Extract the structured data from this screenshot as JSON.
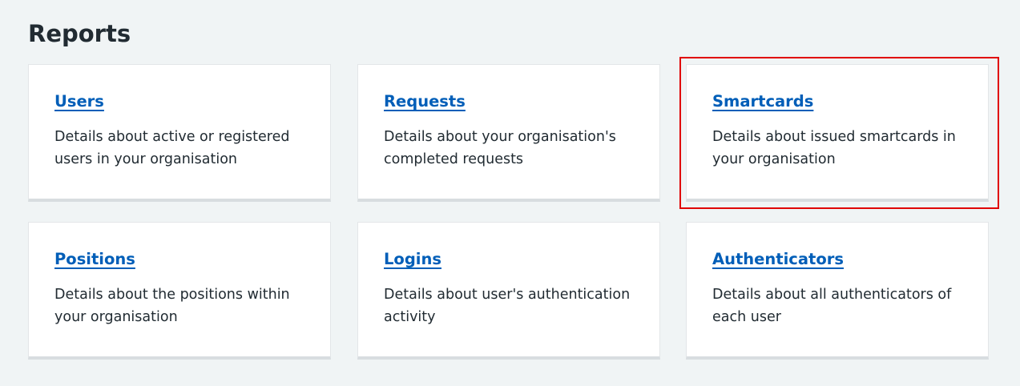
{
  "page": {
    "title": "Reports"
  },
  "cards": [
    {
      "title": "Users",
      "description": "Details about active or registered users in your organisation"
    },
    {
      "title": "Requests",
      "description": "Details about your organisation's completed requests"
    },
    {
      "title": "Smartcards",
      "description": "Details about issued smartcards in your organisation"
    },
    {
      "title": "Positions",
      "description": "Details about the positions within your organisation"
    },
    {
      "title": "Logins",
      "description": "Details about user's authentication activity"
    },
    {
      "title": "Authenticators",
      "description": "Details about all authenticators of each user"
    }
  ],
  "highlight": {
    "target": "Smartcards",
    "color": "#e00000"
  },
  "colors": {
    "link": "#005eb8",
    "text": "#212b32",
    "background": "#f0f4f5",
    "card": "#ffffff"
  }
}
